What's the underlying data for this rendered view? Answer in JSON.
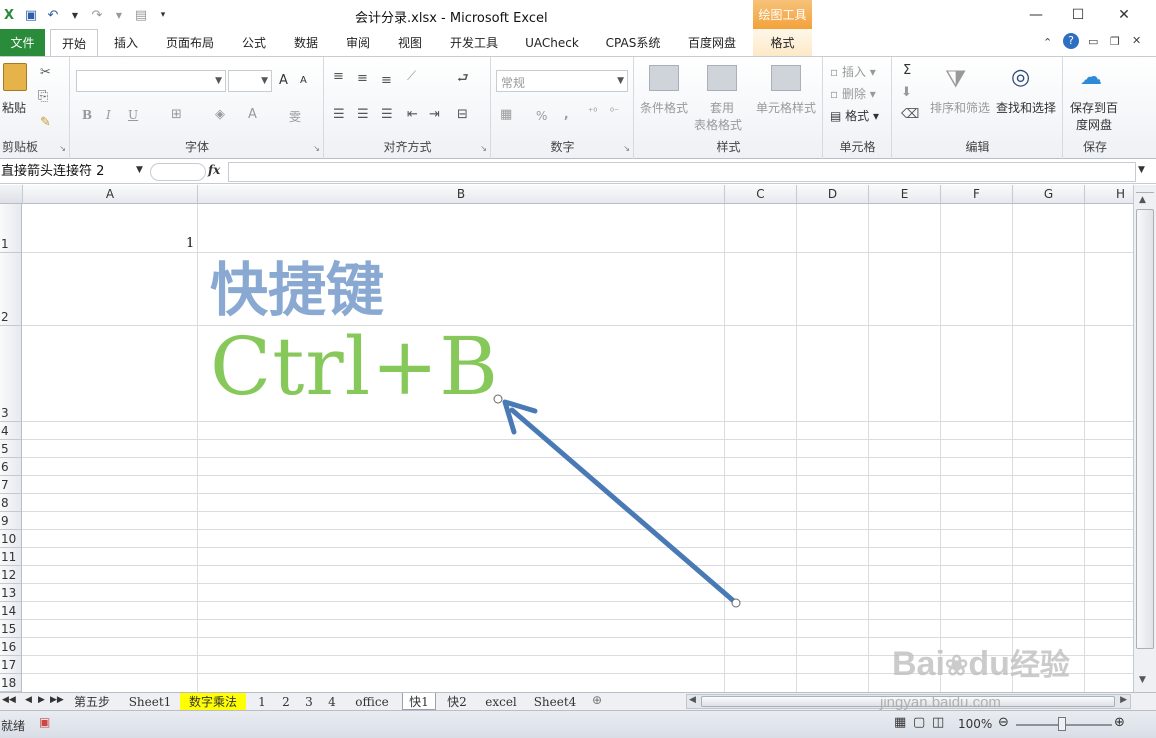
{
  "window": {
    "title": "会计分录.xlsx  -  Microsoft Excel",
    "contextual_tab_group": "绘图工具"
  },
  "tabs": [
    "文件",
    "开始",
    "插入",
    "页面布局",
    "公式",
    "数据",
    "审阅",
    "视图",
    "开发工具",
    "UACheck",
    "CPAS系统",
    "百度网盘",
    "格式"
  ],
  "ribbon": {
    "clipboard": {
      "paste": "粘贴",
      "label": "剪贴板"
    },
    "font": {
      "label": "字体",
      "bold": "B",
      "italic": "I",
      "underline": "U",
      "grow": "A",
      "shrink": "A",
      "wen": "雯"
    },
    "alignment": {
      "label": "对齐方式"
    },
    "number": {
      "format": "常规",
      "label": "数字",
      "percent": "%",
      "comma": ","
    },
    "styles": {
      "conditional": "条件格式",
      "table_line1": "套用",
      "table_line2": "表格格式",
      "cell_styles": "单元格样式",
      "label": "样式"
    },
    "cells": {
      "insert": "插入",
      "delete": "删除",
      "format": "格式",
      "label": "单元格"
    },
    "editing": {
      "sort": "排序和筛选",
      "find": "查找和选择",
      "label": "编辑",
      "sigma": "Σ"
    },
    "save": {
      "line1": "保存到百",
      "line2": "度网盘",
      "label": "保存"
    }
  },
  "formula_bar": {
    "name_box": "直接箭头连接符 2",
    "fx": "fx",
    "content": ""
  },
  "columns": [
    "A",
    "B",
    "C",
    "D",
    "E",
    "F",
    "G",
    "H"
  ],
  "rows": [
    "1",
    "2",
    "3",
    "4",
    "5",
    "6",
    "7",
    "8",
    "9",
    "10",
    "11",
    "12",
    "13",
    "14",
    "15",
    "16",
    "17",
    "18"
  ],
  "cells": {
    "A1": "1"
  },
  "overlay_text": {
    "shortcut_label": "快捷键",
    "shortcut_keys": "Ctrl+B"
  },
  "colors": {
    "shortcut_label": "#8aa9d2",
    "shortcut_keys": "#86c95a",
    "arrow": "#4a7ab5",
    "file_tab": "#2a8b3a",
    "sheet_active_highlight": "#ffff00"
  },
  "sheet_tabs": [
    "第五步",
    "Sheet1",
    "数字乘法",
    "1",
    "2",
    "3",
    "4",
    "office",
    "快1",
    "快2",
    "excel",
    "Sheet4"
  ],
  "active_sheet": "快1",
  "status": {
    "ready": "就绪",
    "zoom": "100%"
  },
  "watermark": {
    "line1": "Bai",
    "line2": "du",
    "line3": "经验",
    "url": "jingyan.baidu.com"
  }
}
